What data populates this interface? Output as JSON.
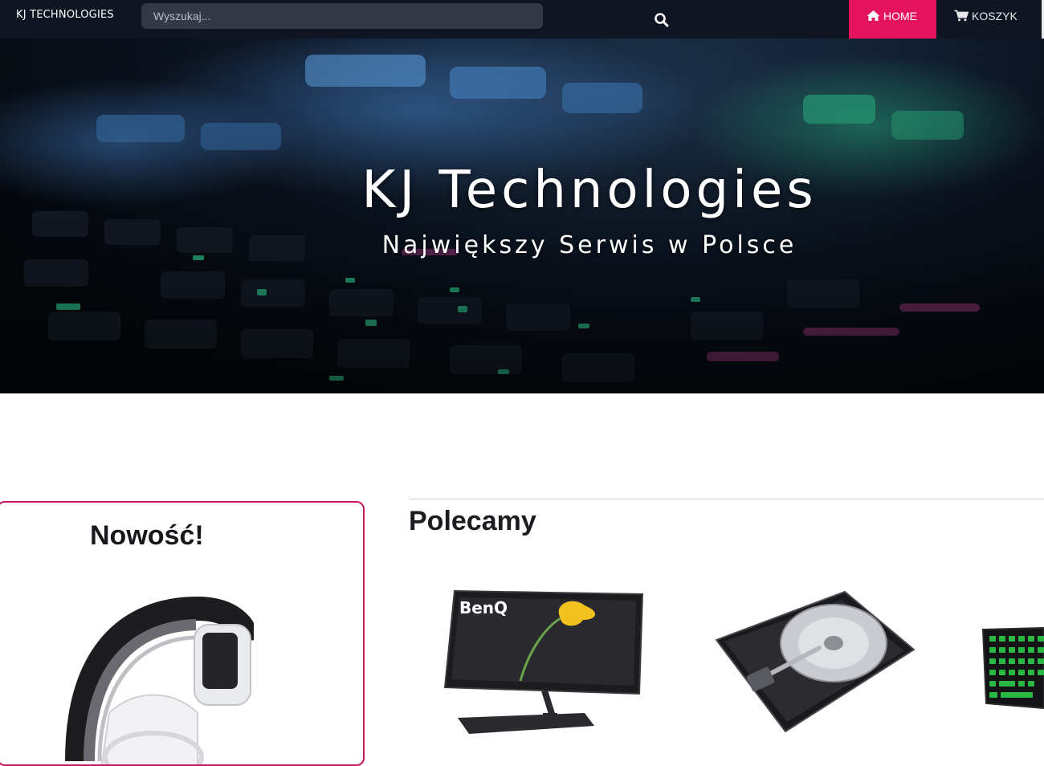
{
  "navbar": {
    "brand": "KJ TECHNOLOGIES",
    "search_placeholder": "Wyszukaj...",
    "search_icon": "search-icon",
    "home_label": "HOME",
    "home_icon": "home-icon",
    "cart_label": "KOSZYK",
    "cart_icon": "cart-icon",
    "accent_color": "#e5125d",
    "background_color": "#0f1521"
  },
  "hero": {
    "title": "KJ Technologies",
    "subtitle": "Największy Serwis w Polsce"
  },
  "new_section": {
    "title": "Nowość!",
    "border_color": "#c8175e",
    "product_image": "headphones-image"
  },
  "recommended": {
    "title": "Polecamy",
    "products": [
      {
        "image": "monitor-image",
        "brand_text": "BenQ"
      },
      {
        "image": "hard-drive-image"
      },
      {
        "image": "keyboard-image"
      }
    ]
  }
}
